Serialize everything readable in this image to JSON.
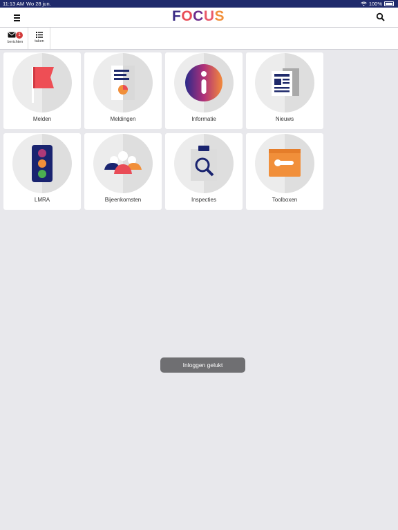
{
  "status_bar": {
    "time": "11:13 AM",
    "date": "Wo 28 jun.",
    "battery": "100%"
  },
  "header": {
    "logo": [
      "F",
      "O",
      "C",
      "U",
      "S"
    ]
  },
  "toolbar": {
    "messages_label": "berichten",
    "messages_badge": "1",
    "tasks_label": "taken"
  },
  "tiles": [
    {
      "label": "Melden",
      "icon": "flag-icon"
    },
    {
      "label": "Meldingen",
      "icon": "report-icon"
    },
    {
      "label": "Informatie",
      "icon": "info-icon"
    },
    {
      "label": "Nieuws",
      "icon": "newspaper-icon"
    },
    {
      "label": "LMRA",
      "icon": "traffic-light-icon"
    },
    {
      "label": "Bijeenkomsten",
      "icon": "group-icon"
    },
    {
      "label": "Inspecties",
      "icon": "clipboard-search-icon"
    },
    {
      "label": "Toolboxen",
      "icon": "toolbox-icon"
    }
  ],
  "toast": {
    "text": "Inloggen gelukt"
  },
  "colors": {
    "status_bar": "#1f2a6b",
    "brand_navy": "#1f2a6b",
    "brand_red": "#e94c57",
    "brand_orange": "#f18f3a",
    "background": "#e8e8ec"
  }
}
